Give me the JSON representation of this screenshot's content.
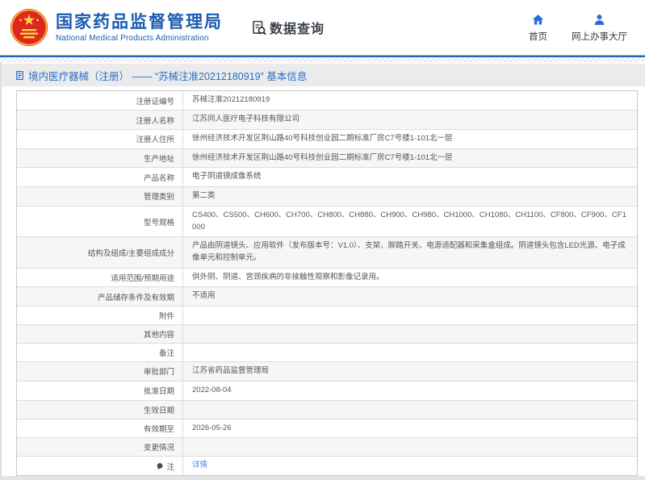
{
  "header": {
    "brand": {
      "title": "国家药品监督管理局",
      "subtitle": "National Medical Products Administration",
      "logo_icon": "national-emblem-icon"
    },
    "section_label": "数据查询",
    "section_icon": "document-search-icon",
    "nav": [
      {
        "label": "首页",
        "icon": "home-icon"
      },
      {
        "label": "网上办事大厅",
        "icon": "user-icon"
      }
    ]
  },
  "breadcrumb": {
    "icon": "document-icon",
    "text": "境内医疗器械（注册） —— “苏械注准20212180919” 基本信息"
  },
  "table": {
    "rows": [
      {
        "label": "注册证编号",
        "value": "苏械注准20212180919"
      },
      {
        "label": "注册人名称",
        "value": "江苏同人医疗电子科技有限公司"
      },
      {
        "label": "注册人住所",
        "value": "徐州经济技术开发区荆山路40号科技创业园二期标准厂房C7号楼1-101北一层"
      },
      {
        "label": "生产地址",
        "value": "徐州经济技术开发区荆山路40号科技创业园二期标准厂房C7号楼1-101北一层"
      },
      {
        "label": "产品名称",
        "value": "电子阴道镜成像系统"
      },
      {
        "label": "管理类别",
        "value": "第二类"
      },
      {
        "label": "型号规格",
        "value": "CS400、CS500、CH600、CH700、CH800、CH880、CH900、CH980、CH1000、CH1080、CH1100、CF800、CF900、CF1000"
      },
      {
        "label": "结构及组成/主要组成成分",
        "value": "产品由阴道镜头、应用软件（发布版本号：V1.0）、支架、脚踏开关、电源适配器和采集盒组成。阴道镜头包含LED光源、电子成像单元和控制单元。"
      },
      {
        "label": "适用范围/预期用途",
        "value": "供外阴、阴道、宫颈疾病的非接触性观察和影像记录用。"
      },
      {
        "label": "产品储存条件及有效期",
        "value": "不适用"
      },
      {
        "label": "附件",
        "value": ""
      },
      {
        "label": "其他内容",
        "value": ""
      },
      {
        "label": "备注",
        "value": ""
      },
      {
        "label": "审批部门",
        "value": "江苏省药品监督管理局"
      },
      {
        "label": "批准日期",
        "value": "2022-08-04"
      },
      {
        "label": "生效日期",
        "value": ""
      },
      {
        "label": "有效期至",
        "value": "2026-05-26"
      },
      {
        "label": "变更情况",
        "value": ""
      },
      {
        "label": "注",
        "icon": "note-icon",
        "value": "详情",
        "link": true
      }
    ]
  },
  "colors": {
    "brand_blue": "#1a5cb0",
    "accent_line_blue": "#1f6cb9",
    "nav_icon_blue": "#2b6bd8",
    "breadcrumb_text_blue": "#2a6fc9",
    "link_blue": "#4285f4",
    "breadcrumb_bg": "#ebebeb",
    "row_alt_bg": "#f6f6f6",
    "emblem_red": "#de281e",
    "emblem_gold": "#f9d648"
  }
}
